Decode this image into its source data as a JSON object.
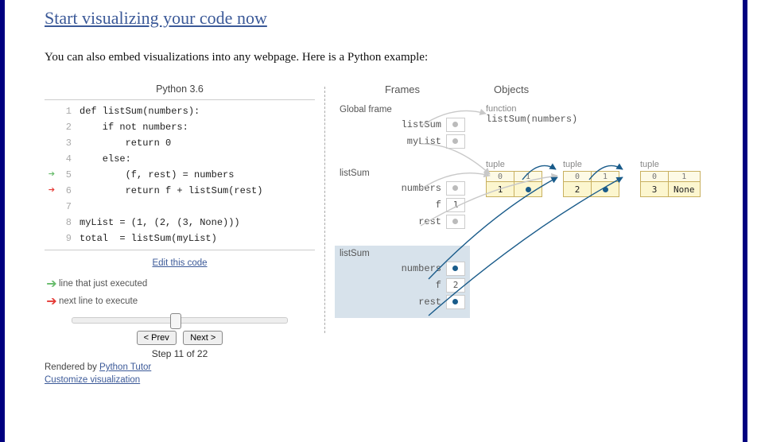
{
  "headline": "Start visualizing your code now",
  "intro": "You can also embed visualizations into any webpage. Here is a Python example:",
  "lang_label": "Python 3.6",
  "code_lines": [
    {
      "n": 1,
      "text": "def listSum(numbers):"
    },
    {
      "n": 2,
      "text": "    if not numbers:"
    },
    {
      "n": 3,
      "text": "        return 0"
    },
    {
      "n": 4,
      "text": "    else:"
    },
    {
      "n": 5,
      "text": "        (f, rest) = numbers"
    },
    {
      "n": 6,
      "text": "        return f + listSum(rest)"
    },
    {
      "n": 7,
      "text": ""
    },
    {
      "n": 8,
      "text": "myList = (1, (2, (3, None)))"
    },
    {
      "n": 9,
      "text": "total  = listSum(myList)"
    }
  ],
  "just_executed_line": 5,
  "next_line": 6,
  "edit_link": "Edit this code",
  "legend_just": "line that just executed",
  "legend_next": "next line to execute",
  "prev_label": "< Prev",
  "next_label": "Next >",
  "step_current": 11,
  "step_total": 22,
  "step_text": "Step 11 of 22",
  "rendered_by_prefix": "Rendered by ",
  "rendered_by_link": "Python Tutor",
  "customize_link": "Customize visualization",
  "frames_header": "Frames",
  "objects_header": "Objects",
  "global_frame": {
    "title": "Global frame",
    "rows": [
      {
        "label": "listSum",
        "kind": "ptr"
      },
      {
        "label": "myList",
        "kind": "ptr"
      }
    ]
  },
  "call_frames": [
    {
      "title": "listSum",
      "rows": [
        {
          "label": "numbers",
          "kind": "ptr"
        },
        {
          "label": "f",
          "kind": "val",
          "value": "1"
        },
        {
          "label": "rest",
          "kind": "ptr"
        }
      ],
      "active": false
    },
    {
      "title": "listSum",
      "rows": [
        {
          "label": "numbers",
          "kind": "ptr"
        },
        {
          "label": "f",
          "kind": "val",
          "value": "2"
        },
        {
          "label": "rest",
          "kind": "ptr"
        }
      ],
      "active": true
    }
  ],
  "objects": {
    "function": {
      "label": "function",
      "sig": "listSum(numbers)"
    },
    "tuples": [
      {
        "label": "tuple",
        "idx": [
          "0",
          "1"
        ],
        "cells": [
          "1",
          "•"
        ]
      },
      {
        "label": "tuple",
        "idx": [
          "0",
          "1"
        ],
        "cells": [
          "2",
          "•"
        ]
      },
      {
        "label": "tuple",
        "idx": [
          "0",
          "1"
        ],
        "cells": [
          "3",
          "None"
        ]
      }
    ]
  }
}
